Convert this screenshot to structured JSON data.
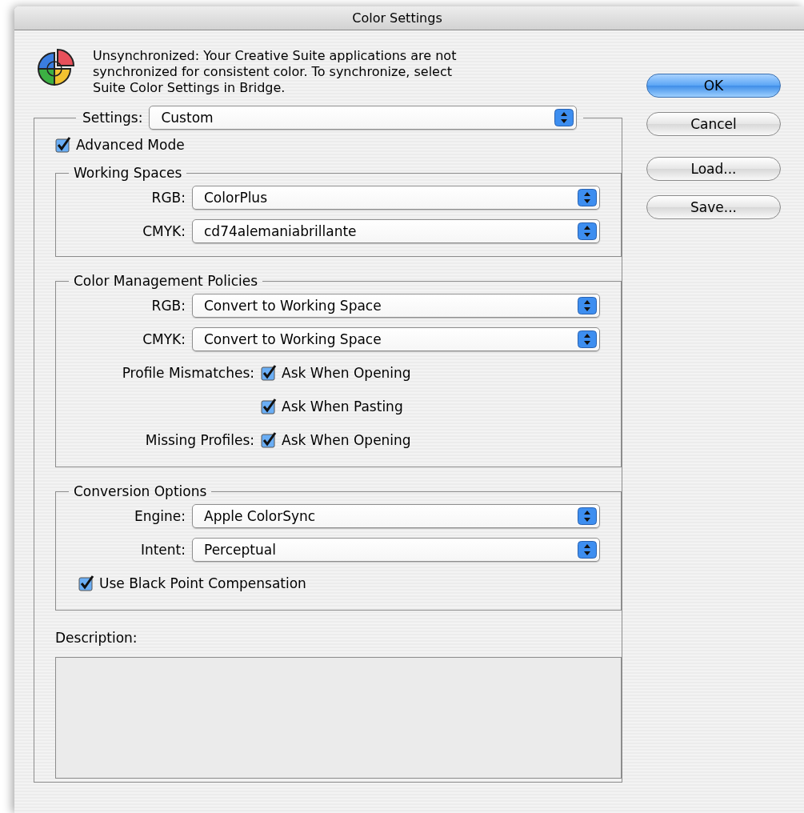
{
  "window": {
    "title": "Color Settings"
  },
  "message": "Unsynchronized: Your Creative Suite applications are not synchronized for consistent color. To synchronize, select Suite Color Settings in Bridge.",
  "buttons": [
    {
      "label": "OK",
      "default": true
    },
    {
      "label": "Cancel",
      "default": false
    },
    {
      "label": "Load...",
      "default": false
    },
    {
      "label": "Save...",
      "default": false
    }
  ],
  "settings": {
    "label": "Settings:",
    "value": "Custom"
  },
  "advanced_mode": {
    "label": "Advanced Mode",
    "checked": true
  },
  "groups": [
    {
      "title": "Working Spaces",
      "rows": [
        {
          "kind": "select",
          "label": "RGB:",
          "value": "ColorPlus"
        },
        {
          "kind": "select",
          "label": "CMYK:",
          "value": "cd74alemaniabrillante"
        }
      ]
    },
    {
      "title": "Color Management Policies",
      "rows": [
        {
          "kind": "select",
          "label": "RGB:",
          "value": "Convert to Working Space"
        },
        {
          "kind": "select",
          "label": "CMYK:",
          "value": "Convert to Working Space"
        },
        {
          "kind": "checkbox",
          "label": "Profile Mismatches:",
          "option": "Ask When Opening",
          "checked": true
        },
        {
          "kind": "checkbox",
          "option": "Ask When Pasting",
          "checked": true
        },
        {
          "kind": "checkbox",
          "label": "Missing Profiles:",
          "option": "Ask When Opening",
          "checked": true
        }
      ]
    },
    {
      "title": "Conversion Options",
      "rows": [
        {
          "kind": "select",
          "label": "Engine:",
          "value": "Apple ColorSync"
        },
        {
          "kind": "select",
          "label": "Intent:",
          "value": "Perceptual"
        },
        {
          "kind": "option",
          "option": "Use Black Point Compensation",
          "checked": true
        }
      ]
    }
  ],
  "description": {
    "label": "Description:"
  }
}
